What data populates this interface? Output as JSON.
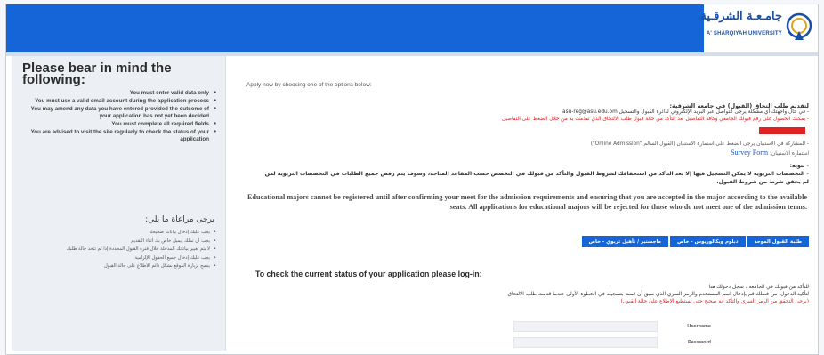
{
  "header": {
    "logo_ar": "جامـعـة الشرقـية",
    "logo_en": "A' SHARQIYAH UNIVERSITY",
    "brand_color": "#1565d8",
    "emblem_icon": "university-emblem-icon"
  },
  "sidebar": {
    "title": "Please bear in mind the following:",
    "items": [
      "You must enter valid data only",
      "You must use a valid email account during the application process",
      "You may amend any data you have entered provided the outcome of your application has not yet been decided",
      "You must complete all required fields",
      "You are advised to visit the site regularly to check the status of your application"
    ],
    "ar_title": "يرجى مراعاة ما يلي:",
    "ar_items": [
      "يجب عليك إدخال بيانات صحيحة",
      "يجب أن تملك إيميل خاص بك أثناء التقديم",
      "لا يتم تغيير بياناتك المدخلة خلال فترة القبول المحددة إذا لم تتخذ حالة طلبك",
      "يجب عليك إدخال جميع الحقول الإلزامية",
      "ينصح بزيارة الموقع بشكل دائم للاطلاع على حالة القبول"
    ]
  },
  "main": {
    "apply_now": "Apply now by choosing one of the options below:",
    "ar_heading": "لتقديم طلب التحاق (القبول) في جامعة الشرقية:",
    "ar_line1": "- في حال واجهتك أي مشكلة يرجى التواصل عبر البريد الإلكتروني لدائرة القبول والتسجيل asu-reg@asu.edu.om",
    "ar_red_line": "- يمكنك الحصول على رقم قبولك الجامعي وكافة التفاصيل بعد التأكد من حالة قبول طلب الالتحاق الذي تقدمت به من خلال الضغط على التفاصيل",
    "ar_online": "- للمشاركة في الاستبيان يرجى الضغط على استمارة الاستبيان (القبول السالم \"Online Admission\")",
    "ar_survey_prefix": "استمارة الاستبيان:",
    "survey_link": "Survey Form",
    "ar_note_heading": "- تنويه:",
    "ar_note": "- التخصصات التربوية لا يمكن التسجيل فيها إلا بعد التأكد من استحقاقك لشروط القبول والتأكد من قبولك في التخصص حسب المقاعد المتاحة، وسوف يتم رفض جميع الطلبات في التخصصات التربوية لمن لم يحقق شرط من شروط القبول.",
    "en_para": "Educational majors cannot be registered until after confirming your meet for the admission requirements and ensuring that you are accepted in the major according to the available seats. All applications for educational majors will be rejected for those who do not meet one of the admission terms.",
    "buttons": [
      "طلبة القبول الموحد",
      "دبلوم وبكالوريوس - خاص",
      "ماجستير / تأهيل تربوي - خاص"
    ],
    "status_title": "To check the current status of your application please log-in:",
    "ar_login1": "للتأكد من قبولك في الجامعة ، سجل دخولك هنا",
    "ar_login2": "لتأكيد الدخول، من فضلك قم بإدخال اسم المستخدم والرمز السري الذي سبق أن قمت بتسجيله في الخطوة الأولى عندما قدمت طلب الالتحاق",
    "ar_login3": "(يرجى التحقق من الرمز السري والتأكد أنه صحيح حتى تستطيع الإطلاع على حالة القبول)",
    "username_label": "Username",
    "password_label": "Password"
  }
}
